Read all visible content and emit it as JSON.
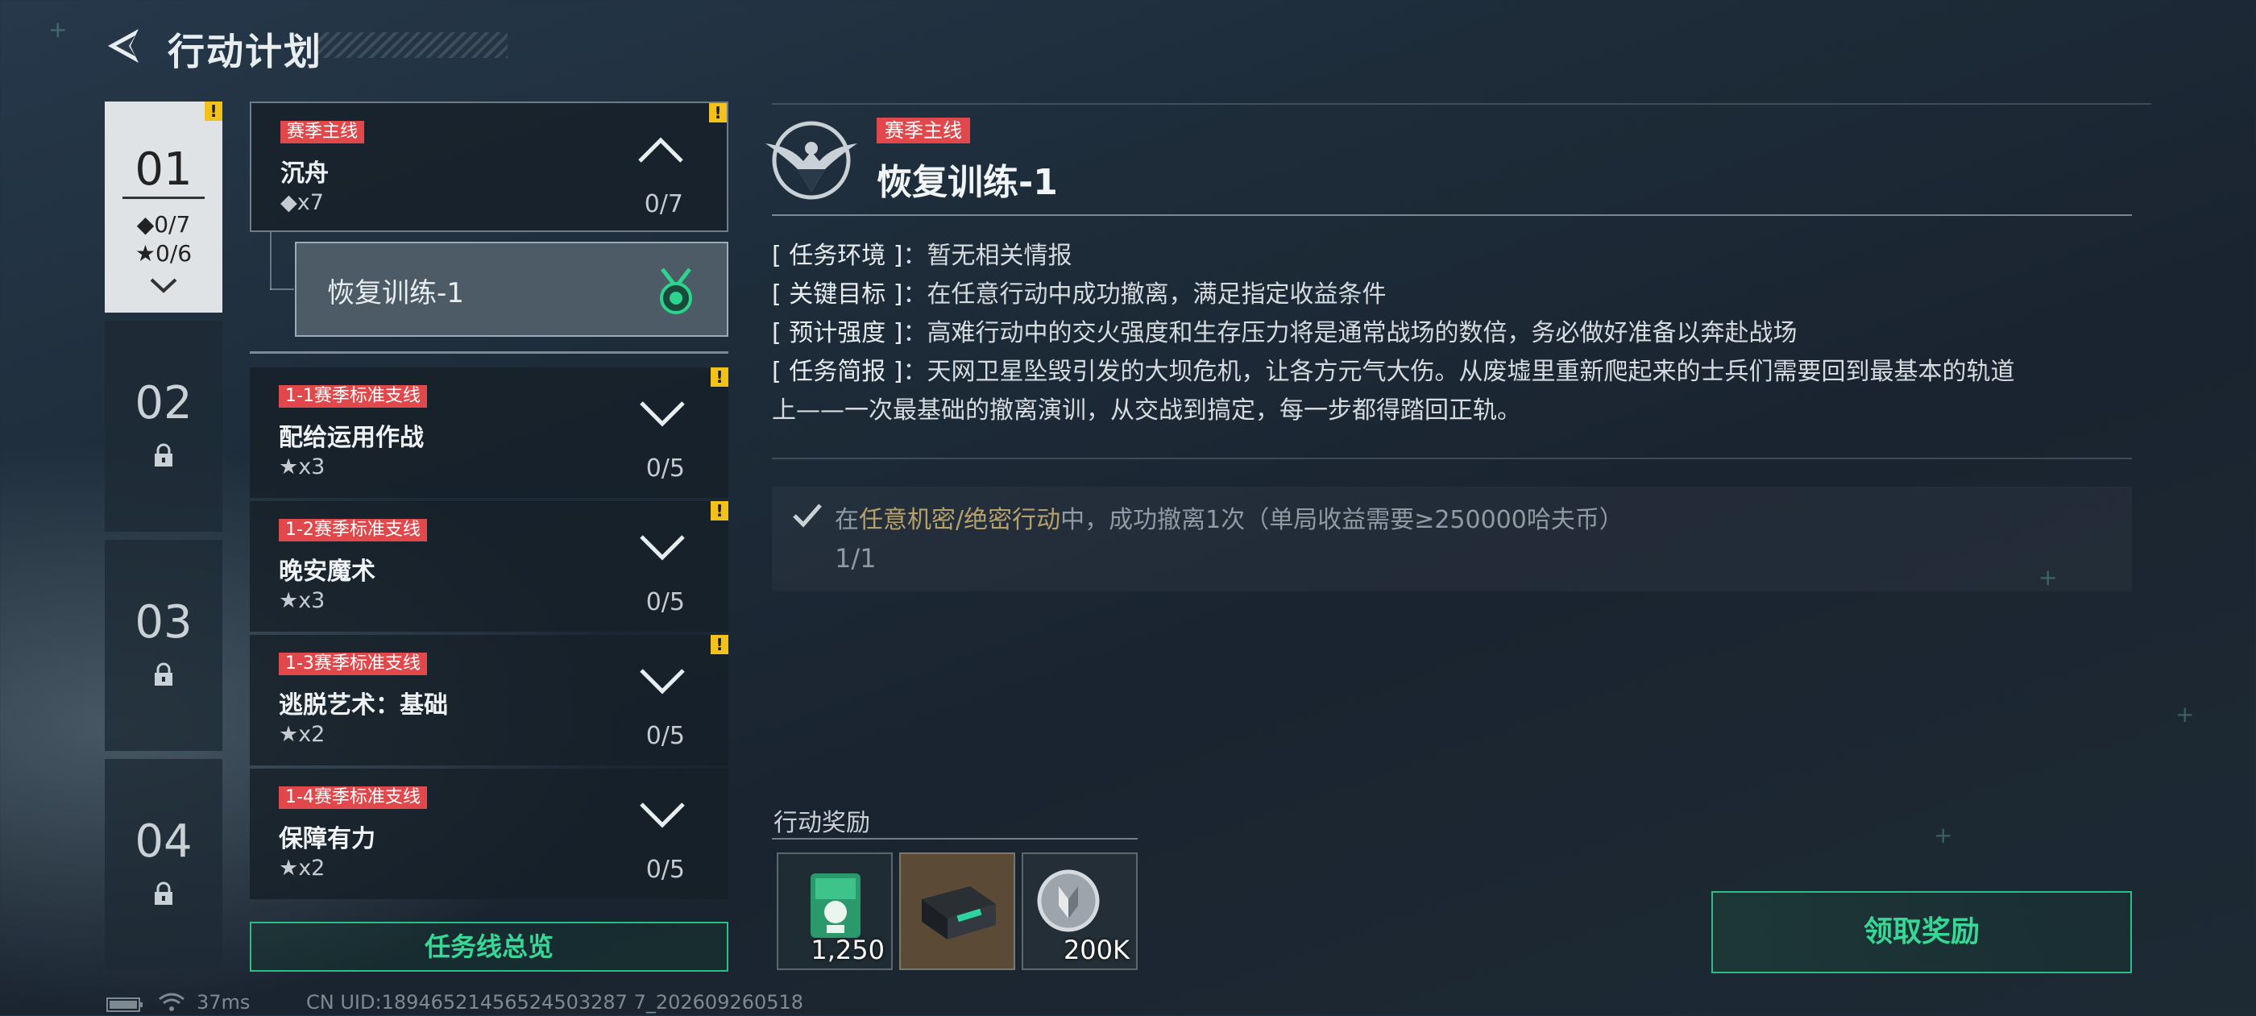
{
  "header": {
    "title": "行动计划"
  },
  "chapters": [
    {
      "num": "01",
      "stat1": "◆0/7",
      "stat2": "★0/6",
      "warning": "!"
    },
    {
      "num": "02"
    },
    {
      "num": "03"
    },
    {
      "num": "04"
    }
  ],
  "missions": [
    {
      "tag": "赛季主线",
      "name": "沉舟",
      "reward": "◆x7",
      "progress": "0/7",
      "warning": "!"
    },
    {
      "tag": "1-1赛季标准支线",
      "name": "配给运用作战",
      "reward": "★x3",
      "progress": "0/5",
      "warning": "!"
    },
    {
      "tag": "1-2赛季标准支线",
      "name": "晚安魔术",
      "reward": "★x3",
      "progress": "0/5",
      "warning": "!"
    },
    {
      "tag": "1-3赛季标准支线",
      "name": "逃脱艺术：基础",
      "reward": "★x2",
      "progress": "0/5",
      "warning": "!"
    },
    {
      "tag": "1-4赛季标准支线",
      "name": "保障有力",
      "reward": "★x2",
      "progress": "0/5"
    }
  ],
  "sub_item": {
    "label": "恢复训练-1"
  },
  "overview_button": "任务线总览",
  "detail": {
    "tag": "赛季主线",
    "title": "恢复训练-1",
    "info": [
      {
        "key": "[ 任务环境 ]",
        "value": "：暂无相关情报"
      },
      {
        "key": "[ 关键目标 ]",
        "value": "：在任意行动中成功撤离，满足指定收益条件"
      },
      {
        "key": "[ 预计强度 ]",
        "value": "：高难行动中的交火强度和生存压力将是通常战场的数倍，务必做好准备以奔赴战场"
      },
      {
        "key": "[ 任务简报 ]",
        "value": "：天网卫星坠毁引发的大坝危机，让各方元气大伤。从废墟里重新爬起来的士兵们需要回到最基本的轨道"
      }
    ],
    "info_cont": "上——一次最基础的撤离演训，从交战到搞定，每一步都得踏回正轨。",
    "objective": {
      "pre": "在",
      "highlight": "任意机密/绝密行动",
      "post": "中，成功撤离1次（单局收益需要≥250000哈夫币）",
      "progress": "1/1"
    }
  },
  "rewards": {
    "label": "行动奖励",
    "items": [
      {
        "icon": "medal-box-icon",
        "qty": "1,250"
      },
      {
        "icon": "equipment-case-icon",
        "qty": ""
      },
      {
        "icon": "coin-icon",
        "qty": "200K"
      }
    ]
  },
  "claim_button": "领取奖励",
  "status": {
    "ping": "37ms",
    "uid": "CN UID:18946521456524503287 7_202609260518"
  },
  "colors": {
    "accent_green": "#37d896",
    "tag_red": "#e0484b",
    "warning_yellow": "#f3c21a"
  }
}
